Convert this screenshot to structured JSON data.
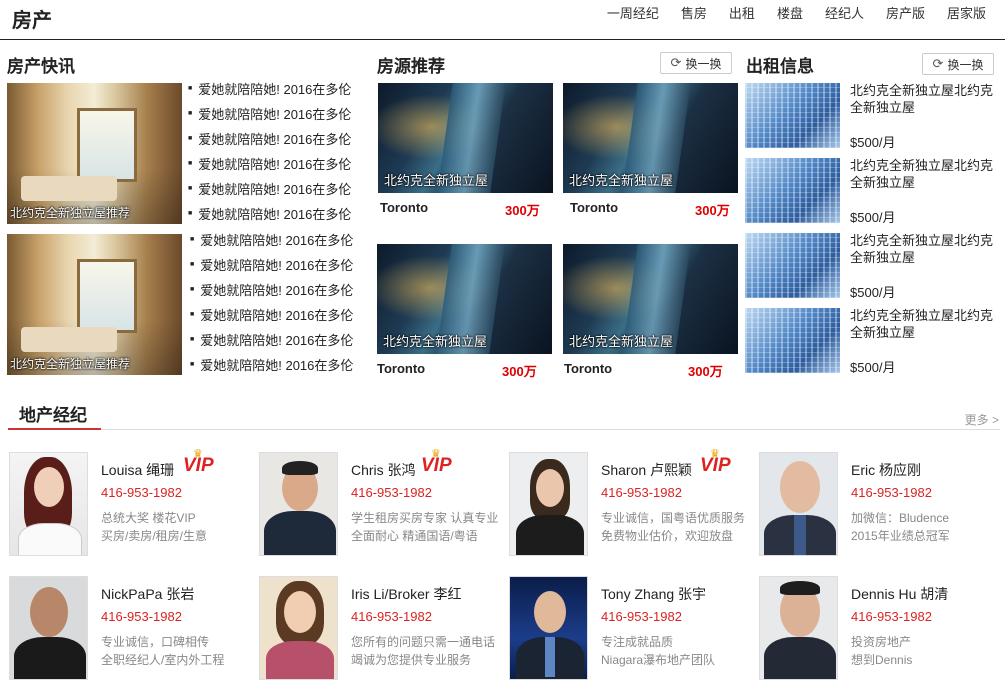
{
  "header": {
    "title": "房产",
    "nav": [
      "一周经纪",
      "售房",
      "出租",
      "楼盘",
      "经纪人",
      "房产版",
      "居家版"
    ]
  },
  "news": {
    "title": "房产快讯",
    "image_caption_1": "北约克全新独立屋推荐",
    "image_caption_2": "北约克全新独立屋推荐",
    "items_1": [
      "爱她就陪陪她! 2016在多伦",
      "爱她就陪陪她! 2016在多伦",
      "爱她就陪陪她! 2016在多伦",
      "爱她就陪陪她! 2016在多伦",
      "爱她就陪陪她! 2016在多伦",
      "爱她就陪陪她! 2016在多伦"
    ],
    "items_2": [
      "爱她就陪陪她! 2016在多伦",
      "爱她就陪陪她! 2016在多伦",
      "爱她就陪陪她! 2016在多伦",
      "爱她就陪陪她! 2016在多伦",
      "爱她就陪陪她! 2016在多伦",
      "爱她就陪陪她! 2016在多伦"
    ]
  },
  "recommend": {
    "title": "房源推荐",
    "swap_label": "换一换",
    "cards": [
      {
        "caption": "北约克全新独立屋",
        "city": "Toronto",
        "price": "300万"
      },
      {
        "caption": "北约克全新独立屋",
        "city": "Toronto",
        "price": "300万"
      },
      {
        "caption": "北约克全新独立屋",
        "city": "Toronto",
        "price": "300万"
      },
      {
        "caption": "北约克全新独立屋",
        "city": "Toronto",
        "price": "300万"
      }
    ]
  },
  "rental": {
    "title": "出租信息",
    "swap_label": "换一换",
    "items": [
      {
        "title": "北约克全新独立屋北约克全新独立屋",
        "price": "$500/月"
      },
      {
        "title": "北约克全新独立屋北约克全新独立屋",
        "price": "$500/月"
      },
      {
        "title": "北约克全新独立屋北约克全新独立屋",
        "price": "$500/月"
      },
      {
        "title": "北约克全新独立屋北约克全新独立屋",
        "price": "$500/月"
      }
    ]
  },
  "agents": {
    "title": "地产经纪",
    "more_label": "更多 >",
    "vip_label": "VIP",
    "list": [
      {
        "name": "Louisa 绳珊",
        "vip": true,
        "phone": "416-953-1982",
        "desc1": "总统大奖 楼花VIP",
        "desc2": "买房/卖房/租房/生意"
      },
      {
        "name": "Chris 张鸿",
        "vip": true,
        "phone": "416-953-1982",
        "desc1": "学生租房买房专家 认真专业",
        "desc2": "全面耐心  精通国语/粤语"
      },
      {
        "name": "Sharon 卢熙颖",
        "vip": true,
        "phone": "416-953-1982",
        "desc1": "专业诚信，国粤语优质服务",
        "desc2": "免费物业估价，欢迎放盘"
      },
      {
        "name": "Eric 杨应刚",
        "vip": false,
        "phone": "416-953-1982",
        "desc1": "加微信：Bludence",
        "desc2": "2015年业绩总冠军"
      },
      {
        "name": "NickPaPa 张岩",
        "vip": false,
        "phone": "416-953-1982",
        "desc1": "专业诚信，口碑相传",
        "desc2": "全职经纪人/室内外工程"
      },
      {
        "name": "Iris Li/Broker 李红",
        "vip": false,
        "phone": "416-953-1982",
        "desc1": "您所有的问题只需一通电话",
        "desc2": "竭诚为您提供专业服务"
      },
      {
        "name": "Tony Zhang 张宇",
        "vip": false,
        "phone": "416-953-1982",
        "desc1": "专注成就品质",
        "desc2": "Niagara瀑布地产团队"
      },
      {
        "name": "Dennis Hu 胡清",
        "vip": false,
        "phone": "416-953-1982",
        "desc1": "投资房地产",
        "desc2": "想到Dennis"
      }
    ]
  }
}
